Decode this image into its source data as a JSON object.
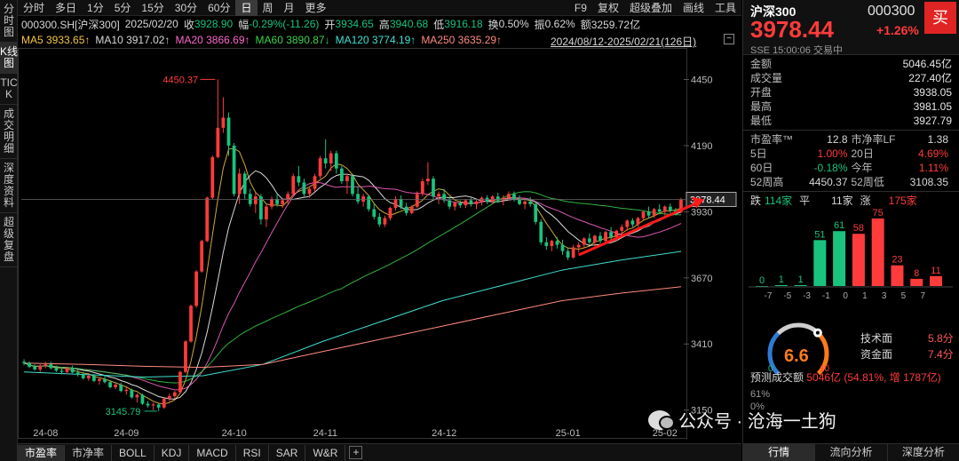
{
  "colors": {
    "up": "#ff3b3b",
    "down": "#19c37d",
    "ma5": "#f5c542",
    "ma10": "#ffffff",
    "ma20": "#ff66cc",
    "ma60": "#3ad24a",
    "ma120": "#40e0d0",
    "ma250": "#ff8a80",
    "accent_buy": "#e02424"
  },
  "left_tabs": [
    "分时图",
    "K线图",
    "TICK",
    "成交明细",
    "深度资料",
    "超级复盘"
  ],
  "left_tab_active": 1,
  "toolbar": {
    "left": [
      "分时",
      "多日",
      "1分",
      "5分",
      "15分",
      "30分",
      "60分",
      "日",
      "周",
      "月",
      "更多"
    ],
    "active": "日",
    "right": [
      "F9",
      "复权",
      "超级叠加",
      "画线",
      "工具"
    ]
  },
  "quote_line": {
    "code": "000300.SH[沪深300]",
    "date": "2025/02/20",
    "close_label": "收",
    "close": "3928.90",
    "change_label": "幅",
    "change": "-0.29%(-11.26)",
    "open_label": "开",
    "open": "3934.65",
    "high_label": "高",
    "high": "3940.68",
    "low_label": "低",
    "low": "3916.18",
    "turnover_label": "换",
    "turnover": "0.50%",
    "amplitude_label": "振",
    "amplitude": "0.62%",
    "amount_label": "额",
    "amount": "3259.72亿"
  },
  "ma_line": {
    "ma5": "MA5 3933.65↑",
    "ma10": "MA10 3917.02↑",
    "ma20": "MA20 3866.69↑",
    "ma60": "MA60 3890.87↓",
    "ma120": "MA120 3774.19↑",
    "ma250": "MA250 3635.29↑"
  },
  "range_label": "2024/08/12-2025/02/21(126日)",
  "minus_label": "−",
  "chart_data": {
    "type": "candlestick",
    "y_ticks": [
      "4450",
      "4190",
      "3930",
      "3670",
      "3410",
      "3150"
    ],
    "ylim": [
      3100,
      4560
    ],
    "x_ticks": [
      {
        "label": "24-08",
        "index": 4
      },
      {
        "label": "24-09",
        "index": 19
      },
      {
        "label": "24-10",
        "index": 39
      },
      {
        "label": "24-11",
        "index": 56
      },
      {
        "label": "24-12",
        "index": 78
      },
      {
        "label": "25-01",
        "index": 101
      },
      {
        "label": "25-02",
        "index": 119
      }
    ],
    "annotations": {
      "high": "4450.37",
      "low": "3145.79",
      "last": "3978.44"
    },
    "annotation_values": {
      "high": 4450.37,
      "high_index": 36,
      "low": 3145.79,
      "low_index": 25,
      "last": 3978.44
    },
    "trend_arrow": {
      "from": [
        103,
        3760
      ],
      "to": [
        125,
        3978
      ]
    },
    "candles": [
      [
        3340,
        3350,
        3326,
        3335
      ],
      [
        3335,
        3342,
        3315,
        3320
      ],
      [
        3320,
        3330,
        3305,
        3310
      ],
      [
        3310,
        3330,
        3300,
        3325
      ],
      [
        3325,
        3340,
        3315,
        3330
      ],
      [
        3330,
        3340,
        3310,
        3315
      ],
      [
        3315,
        3325,
        3300,
        3305
      ],
      [
        3305,
        3318,
        3290,
        3300
      ],
      [
        3300,
        3320,
        3292,
        3315
      ],
      [
        3315,
        3325,
        3295,
        3298
      ],
      [
        3298,
        3310,
        3282,
        3290
      ],
      [
        3290,
        3300,
        3270,
        3275
      ],
      [
        3275,
        3290,
        3265,
        3285
      ],
      [
        3285,
        3292,
        3260,
        3265
      ],
      [
        3265,
        3280,
        3250,
        3272
      ],
      [
        3272,
        3285,
        3255,
        3260
      ],
      [
        3260,
        3268,
        3235,
        3240
      ],
      [
        3240,
        3255,
        3232,
        3250
      ],
      [
        3250,
        3258,
        3220,
        3225
      ],
      [
        3225,
        3240,
        3210,
        3230
      ],
      [
        3230,
        3235,
        3195,
        3200
      ],
      [
        3200,
        3215,
        3180,
        3210
      ],
      [
        3210,
        3215,
        3170,
        3175
      ],
      [
        3175,
        3185,
        3160,
        3168
      ],
      [
        3168,
        3180,
        3150,
        3172
      ],
      [
        3172,
        3178,
        3146,
        3160
      ],
      [
        3160,
        3200,
        3155,
        3195
      ],
      [
        3195,
        3215,
        3185,
        3205
      ],
      [
        3205,
        3225,
        3195,
        3220
      ],
      [
        3220,
        3305,
        3215,
        3300
      ],
      [
        3300,
        3425,
        3295,
        3420
      ],
      [
        3420,
        3565,
        3415,
        3560
      ],
      [
        3560,
        3700,
        3552,
        3695
      ],
      [
        3695,
        3820,
        3690,
        3815
      ],
      [
        3815,
        3990,
        3810,
        3985
      ],
      [
        3985,
        4150,
        3980,
        4145
      ],
      [
        4145,
        4450,
        4140,
        4260
      ],
      [
        4260,
        4380,
        4240,
        4300
      ],
      [
        4300,
        4320,
        4150,
        4190
      ],
      [
        4190,
        4200,
        3990,
        4000
      ],
      [
        4000,
        4100,
        3960,
        4080
      ],
      [
        4080,
        4090,
        3980,
        4000
      ],
      [
        4000,
        4020,
        3950,
        3960
      ],
      [
        3960,
        4005,
        3925,
        3990
      ],
      [
        3990,
        4000,
        3880,
        3900
      ],
      [
        3900,
        3960,
        3870,
        3950
      ],
      [
        3950,
        3990,
        3940,
        3980
      ],
      [
        3980,
        4000,
        3950,
        3960
      ],
      [
        3960,
        3985,
        3945,
        3975
      ],
      [
        3975,
        4010,
        3960,
        4000
      ],
      [
        4000,
        4080,
        3990,
        4070
      ],
      [
        4070,
        4110,
        4030,
        4045
      ],
      [
        4045,
        4060,
        3990,
        4000
      ],
      [
        4000,
        4030,
        3985,
        4020
      ],
      [
        4020,
        4080,
        4010,
        4070
      ],
      [
        4070,
        4150,
        4060,
        4140
      ],
      [
        4140,
        4215,
        4100,
        4120
      ],
      [
        4120,
        4170,
        4090,
        4160
      ],
      [
        4160,
        4170,
        4080,
        4100
      ],
      [
        4100,
        4110,
        4040,
        4050
      ],
      [
        4050,
        4080,
        4000,
        4070
      ],
      [
        4070,
        4075,
        3990,
        4000
      ],
      [
        4000,
        4030,
        3960,
        3970
      ],
      [
        3970,
        4000,
        3950,
        3990
      ],
      [
        3990,
        3995,
        3930,
        3940
      ],
      [
        3940,
        3960,
        3900,
        3910
      ],
      [
        3910,
        3925,
        3870,
        3880
      ],
      [
        3880,
        3915,
        3870,
        3905
      ],
      [
        3905,
        3950,
        3895,
        3945
      ],
      [
        3945,
        3990,
        3935,
        3980
      ],
      [
        3980,
        3995,
        3940,
        3950
      ],
      [
        3950,
        3965,
        3915,
        3925
      ],
      [
        3925,
        3955,
        3920,
        3950
      ],
      [
        3950,
        4010,
        3945,
        4000
      ],
      [
        4000,
        4060,
        3990,
        4050
      ],
      [
        4050,
        4125,
        4035,
        4060
      ],
      [
        4060,
        4070,
        3980,
        3990
      ],
      [
        3990,
        4010,
        3960,
        4000
      ],
      [
        4000,
        4020,
        3965,
        3975
      ],
      [
        3975,
        3990,
        3940,
        3950
      ],
      [
        3950,
        3970,
        3935,
        3965
      ],
      [
        3965,
        3975,
        3945,
        3955
      ],
      [
        3955,
        3980,
        3945,
        3975
      ],
      [
        3975,
        3985,
        3950,
        3960
      ],
      [
        3960,
        3978,
        3940,
        3970
      ],
      [
        3970,
        3990,
        3955,
        3985
      ],
      [
        3985,
        3995,
        3960,
        3970
      ],
      [
        3970,
        3995,
        3960,
        3990
      ],
      [
        3990,
        4005,
        3965,
        3975
      ],
      [
        3975,
        3995,
        3955,
        3985
      ],
      [
        3985,
        4010,
        3975,
        4000
      ],
      [
        4000,
        4010,
        3970,
        3980
      ],
      [
        3980,
        3995,
        3955,
        3960
      ],
      [
        3960,
        3975,
        3940,
        3970
      ],
      [
        3970,
        3988,
        3950,
        3960
      ],
      [
        3960,
        3970,
        3880,
        3890
      ],
      [
        3890,
        3900,
        3800,
        3810
      ],
      [
        3810,
        3830,
        3780,
        3795
      ],
      [
        3795,
        3820,
        3775,
        3815
      ],
      [
        3815,
        3830,
        3785,
        3800
      ],
      [
        3800,
        3820,
        3760,
        3775
      ],
      [
        3775,
        3790,
        3740,
        3750
      ],
      [
        3750,
        3800,
        3745,
        3790
      ],
      [
        3790,
        3810,
        3770,
        3800
      ],
      [
        3800,
        3830,
        3785,
        3825
      ],
      [
        3825,
        3845,
        3800,
        3810
      ],
      [
        3810,
        3840,
        3795,
        3835
      ],
      [
        3835,
        3850,
        3805,
        3815
      ],
      [
        3815,
        3855,
        3810,
        3850
      ],
      [
        3850,
        3870,
        3820,
        3830
      ],
      [
        3830,
        3860,
        3815,
        3855
      ],
      [
        3855,
        3880,
        3840,
        3870
      ],
      [
        3870,
        3900,
        3855,
        3895
      ],
      [
        3895,
        3905,
        3870,
        3880
      ],
      [
        3880,
        3910,
        3870,
        3905
      ],
      [
        3905,
        3935,
        3895,
        3930
      ],
      [
        3930,
        3950,
        3905,
        3915
      ],
      [
        3915,
        3945,
        3905,
        3940
      ],
      [
        3940,
        3960,
        3920,
        3930
      ],
      [
        3930,
        3955,
        3915,
        3950
      ],
      [
        3950,
        3962,
        3925,
        3934
      ],
      [
        3934,
        3945,
        3916,
        3929
      ],
      [
        3929,
        3985,
        3925,
        3978
      ]
    ]
  },
  "panel": {
    "name": "沪深300",
    "code": "000300",
    "buy": "买",
    "price": "3978.44",
    "pct": "+1.26%",
    "sub": "SSE  15:00:06  交易中",
    "stats": [
      {
        "k": "金额",
        "v": "5046.45亿",
        "c": "w"
      },
      {
        "k": "成交量",
        "v": "227.40亿",
        "c": "w"
      },
      {
        "k": "开盘",
        "v": "3938.05",
        "c": "red"
      },
      {
        "k": "最高",
        "v": "3981.05",
        "c": "red"
      },
      {
        "k": "最低",
        "v": "3927.79",
        "c": "grn"
      }
    ],
    "grid": [
      {
        "k": "市盈率™",
        "v": "12.8",
        "c": "w"
      },
      {
        "k": "市净率LF",
        "v": "1.38",
        "c": "w"
      },
      {
        "k": "5日",
        "v": "1.00%",
        "c": "red"
      },
      {
        "k": "20日",
        "v": "4.69%",
        "c": "red"
      },
      {
        "k": "60日",
        "v": "-0.18%",
        "c": "grn"
      },
      {
        "k": "今年",
        "v": "1.11%",
        "c": "red"
      },
      {
        "k": "52周高",
        "v": "4450.37",
        "c": "w"
      },
      {
        "k": "52周低",
        "v": "3108.35",
        "c": "w"
      }
    ],
    "breadth": {
      "fall_label": "跌",
      "fall": "114家",
      "flat_label": "平",
      "flat": "11家",
      "rise_label": "涨",
      "rise": "175家"
    },
    "histogram": {
      "values": [
        0,
        1,
        1,
        51,
        61,
        58,
        75,
        23,
        8,
        11
      ],
      "labels": [
        "-7",
        "-5",
        "-3",
        "-1",
        "0",
        "1",
        "3",
        "5",
        "7"
      ],
      "colors": [
        "down",
        "down",
        "down",
        "down",
        "down",
        "up",
        "up",
        "up",
        "up",
        "up"
      ]
    },
    "gauge": {
      "value": "6.6",
      "min": "0",
      "max": "10",
      "level": 0.66
    },
    "tech_label": "技术面",
    "tech_value": "5.8分",
    "fund_label": "资金面",
    "fund_value": "7.4分",
    "predict_label": "预测成交额",
    "predict_value": "5046亿 (54.81%, 增 1787亿)",
    "pct_top": "61%",
    "pct_bottom": "0%",
    "tabs": [
      "行情",
      "流向分析",
      "深度分析"
    ]
  },
  "bottom_tabs": [
    "市盈率",
    "市净率",
    "BOLL",
    "KDJ",
    "MACD",
    "RSI",
    "SAR",
    "W&R",
    "+"
  ],
  "watermark": "公众号 · 沧海一土狗"
}
